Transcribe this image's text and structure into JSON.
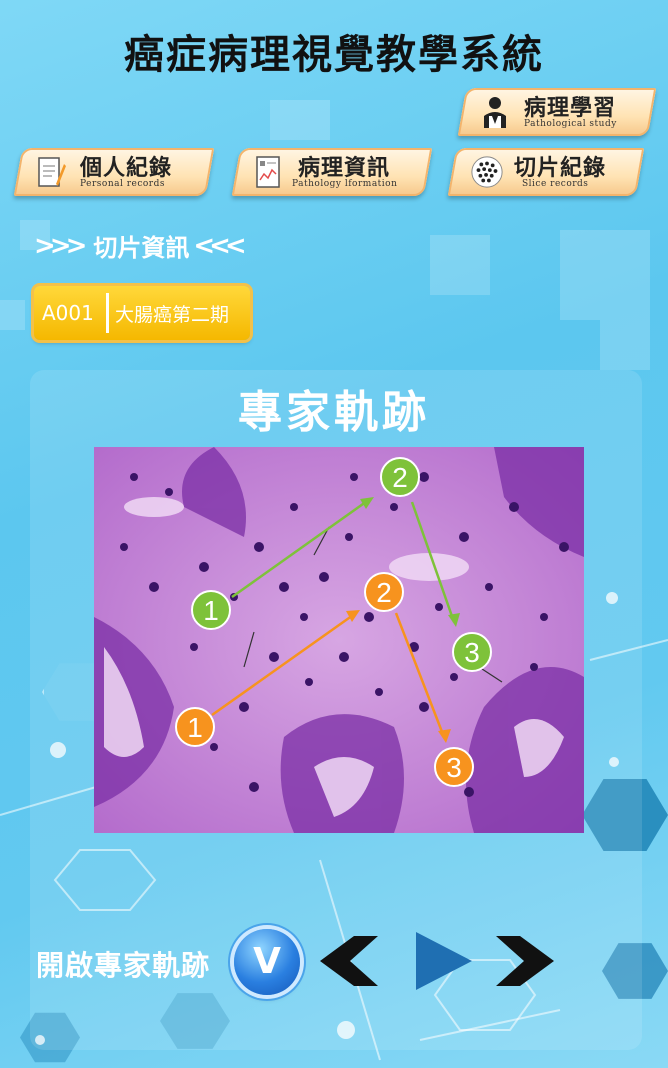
{
  "app_title": "癌症病理視覺教學系統",
  "nav": {
    "pathology_study": {
      "label": "病理學習",
      "sub": "Pathological study"
    },
    "personal_records": {
      "label": "個人紀錄",
      "sub": "Personal records"
    },
    "pathology_info": {
      "label": "病理資訊",
      "sub": "Pathology lformation"
    },
    "slice_records": {
      "label": "切片紀錄",
      "sub": "Slice    records"
    }
  },
  "section_heading": "切片資訊",
  "case": {
    "id": "A001",
    "name": "大腸癌第二期"
  },
  "panel_title": "專家軌跡",
  "trajectory": {
    "green": {
      "color": "#7ec23a",
      "labels": [
        "1",
        "2",
        "3"
      ]
    },
    "orange": {
      "color": "#f7931e",
      "labels": [
        "1",
        "2",
        "3"
      ]
    }
  },
  "controls": {
    "toggle_label": "開啟專家軌跡",
    "toggle_button": "V"
  },
  "colors": {
    "accent_orange": "#f7931e",
    "accent_green": "#7ec23a",
    "pill_yellow": "#f5b800"
  }
}
